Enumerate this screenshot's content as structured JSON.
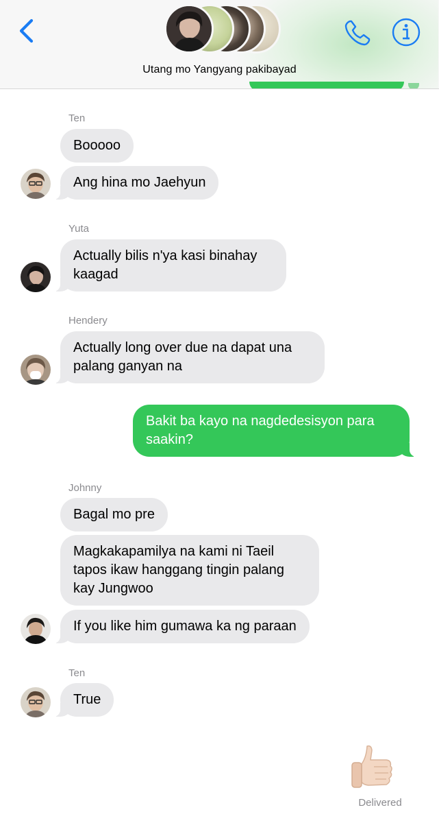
{
  "header": {
    "back_icon": "chevron-left-icon",
    "title": "Utang mo Yangyang pakibayad",
    "call_icon": "phone-icon",
    "info_icon": "info-icon",
    "accent_color": "#1a7cf3"
  },
  "thread": [
    {
      "sender": "Ten",
      "messages": [
        "Booooo",
        "Ang hina mo Jaehyun"
      ]
    },
    {
      "sender": "Yuta",
      "messages": [
        "Actually bilis n'ya kasi binahay kaagad"
      ]
    },
    {
      "sender": "Hendery",
      "messages": [
        "Actually long over due na dapat una palang ganyan na"
      ]
    },
    {
      "sender": "Me",
      "messages": [
        "Bakit ba kayo na nagdedesisyon para saakin?"
      ]
    },
    {
      "sender": "Johnny",
      "messages": [
        "Bagal mo pre",
        "Magkakapamilya na kami ni Taeil tapos ikaw hanggang tingin palang kay Jungwoo",
        "If you like him gumawa ka ng paraan"
      ]
    },
    {
      "sender": "Ten",
      "messages": [
        "True"
      ]
    }
  ],
  "reaction": {
    "icon": "thumbs-up-icon"
  },
  "status": {
    "delivered": "Delivered"
  },
  "colors": {
    "incoming_bubble": "#e9e9eb",
    "outgoing_bubble": "#34c759",
    "secondary_text": "#8a8a8e"
  }
}
